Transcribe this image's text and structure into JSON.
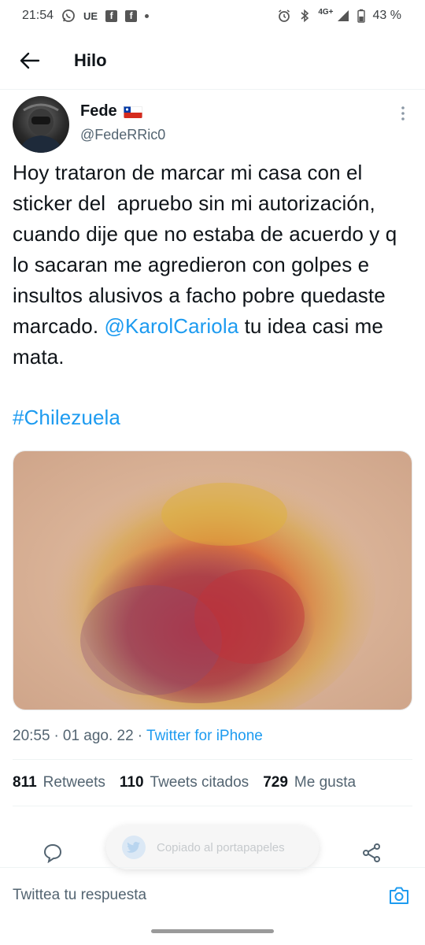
{
  "status_bar": {
    "time": "21:54",
    "carrier_tag": "UE",
    "network": "4G+",
    "battery": "43 %",
    "icons": [
      "whatsapp-icon",
      "facebook-icon",
      "facebook-icon",
      "dot-icon",
      "alarm-icon",
      "bluetooth-icon",
      "signal-icon",
      "battery-icon"
    ]
  },
  "header": {
    "title": "Hilo",
    "back_icon": "arrow-left-icon"
  },
  "tweet": {
    "author_name": "Fede",
    "author_flag": "chile-flag",
    "handle": "@FedeRRic0",
    "text_before": "Hoy trataron de marcar mi casa con el sticker del  apruebo sin mi autorización, cuando dije que no estaba de acuerdo y q lo sacaran me agredieron con golpes e insultos alusivos a facho pobre quedaste marcado. ",
    "mention": "@KarolCariola",
    "text_after": " tu idea casi me mata.",
    "hashtag": "#Chilezuela",
    "time": "20:55",
    "separator": "·",
    "date": "01 ago. 22",
    "source": "Twitter for iPhone"
  },
  "stats": [
    {
      "count": "811",
      "label": "Retweets"
    },
    {
      "count": "110",
      "label": "Tweets citados"
    },
    {
      "count": "729",
      "label": "Me gusta"
    }
  ],
  "actions": [
    "reply-icon",
    "share-icon"
  ],
  "toast": {
    "text": "Copiado al portapapeles",
    "icon": "twitter-bird-icon"
  },
  "reply_bar": {
    "placeholder": "Twittea tu respuesta",
    "camera_icon": "camera-icon"
  },
  "colors": {
    "link": "#1d9bf0",
    "text": "#0f1419",
    "secondary": "#536471",
    "divider": "#eff3f4"
  }
}
